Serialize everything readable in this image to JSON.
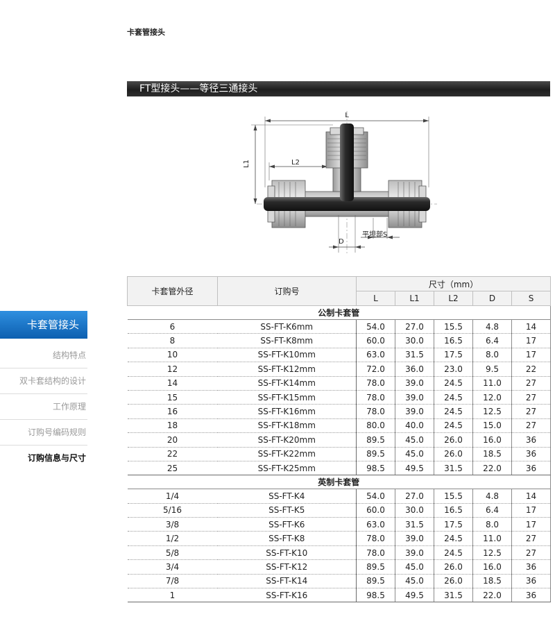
{
  "breadcrumb": "卡套管接头",
  "section_title": "FT型接头——等径三通接头",
  "diagram": {
    "label_L": "L",
    "label_L1": "L1",
    "label_L2": "L2",
    "label_D": "D",
    "label_S": "平坦部S"
  },
  "sidebar": {
    "active": "卡套管接头",
    "items": [
      "结构特点",
      "双卡套结构的设计",
      "工作原理",
      "订购号编码规则",
      "订购信息与尺寸"
    ]
  },
  "table": {
    "col_od": "卡套管外径",
    "col_order": "订购号",
    "col_dim": "尺寸（mm）",
    "dim_cols": [
      "L",
      "L1",
      "L2",
      "D",
      "S"
    ],
    "groups": [
      {
        "title": "公制卡套管",
        "rows": [
          [
            "6",
            "SS-FT-K6mm",
            "54.0",
            "27.0",
            "15.5",
            "4.8",
            "14"
          ],
          [
            "8",
            "SS-FT-K8mm",
            "60.0",
            "30.0",
            "16.5",
            "6.4",
            "17"
          ],
          [
            "10",
            "SS-FT-K10mm",
            "63.0",
            "31.5",
            "17.5",
            "8.0",
            "17"
          ],
          [
            "12",
            "SS-FT-K12mm",
            "72.0",
            "36.0",
            "23.0",
            "9.5",
            "22"
          ],
          [
            "14",
            "SS-FT-K14mm",
            "78.0",
            "39.0",
            "24.5",
            "11.0",
            "27"
          ],
          [
            "15",
            "SS-FT-K15mm",
            "78.0",
            "39.0",
            "24.5",
            "12.0",
            "27"
          ],
          [
            "16",
            "SS-FT-K16mm",
            "78.0",
            "39.0",
            "24.5",
            "12.5",
            "27"
          ],
          [
            "18",
            "SS-FT-K18mm",
            "80.0",
            "40.0",
            "24.5",
            "15.0",
            "27"
          ],
          [
            "20",
            "SS-FT-K20mm",
            "89.5",
            "45.0",
            "26.0",
            "16.0",
            "36"
          ],
          [
            "22",
            "SS-FT-K22mm",
            "89.5",
            "45.0",
            "26.0",
            "18.5",
            "36"
          ],
          [
            "25",
            "SS-FT-K25mm",
            "98.5",
            "49.5",
            "31.5",
            "22.0",
            "36"
          ]
        ]
      },
      {
        "title": "英制卡套管",
        "rows": [
          [
            "1/4",
            "SS-FT-K4",
            "54.0",
            "27.0",
            "15.5",
            "4.8",
            "14"
          ],
          [
            "5/16",
            "SS-FT-K5",
            "60.0",
            "30.0",
            "16.5",
            "6.4",
            "17"
          ],
          [
            "3/8",
            "SS-FT-K6",
            "63.0",
            "31.5",
            "17.5",
            "8.0",
            "17"
          ],
          [
            "1/2",
            "SS-FT-K8",
            "78.0",
            "39.0",
            "24.5",
            "11.0",
            "27"
          ],
          [
            "5/8",
            "SS-FT-K10",
            "78.0",
            "39.0",
            "24.5",
            "12.5",
            "27"
          ],
          [
            "3/4",
            "SS-FT-K12",
            "89.5",
            "45.0",
            "26.0",
            "16.0",
            "36"
          ],
          [
            "7/8",
            "SS-FT-K14",
            "89.5",
            "45.0",
            "26.0",
            "18.5",
            "36"
          ],
          [
            "1",
            "SS-FT-K16",
            "98.5",
            "49.5",
            "31.5",
            "22.0",
            "36"
          ]
        ]
      }
    ]
  }
}
